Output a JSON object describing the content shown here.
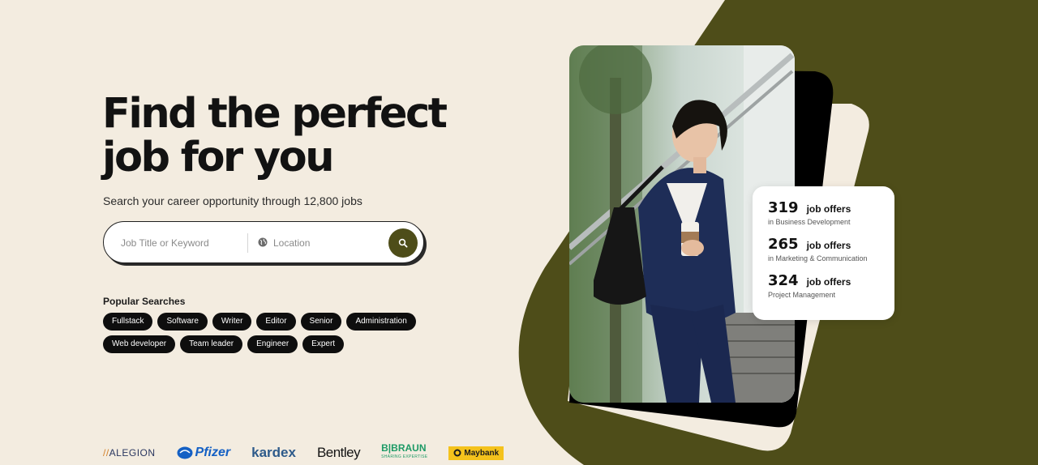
{
  "hero": {
    "title_line1": "Find the perfect",
    "title_line2": "job for you",
    "subtitle": "Search your career opportunity through 12,800 jobs"
  },
  "search": {
    "job_placeholder": "Job Title or Keyword",
    "location_placeholder": "Location",
    "icons": {
      "location": "globe-icon",
      "submit": "search-icon"
    }
  },
  "popular": {
    "heading": "Popular Searches",
    "row1": [
      "Fullstack",
      "Software",
      "Writer",
      "Editor",
      "Senior",
      "Administration"
    ],
    "row2": [
      "Web developer",
      "Team leader",
      "Engineer",
      "Expert"
    ]
  },
  "stats": [
    {
      "count": "319",
      "label": "job offers",
      "category": "in Business Development"
    },
    {
      "count": "265",
      "label": "job offers",
      "category": "in Marketing & Communication"
    },
    {
      "count": "324",
      "label": "job offers",
      "category": "Project Management"
    }
  ],
  "logos": {
    "alegion_prefix": "//",
    "alegion": "ALEGION",
    "pfizer": "Pfizer",
    "kardex": "kardex",
    "bentley": "Bentley",
    "bbraun": "B|BRAUN",
    "bbraun_tagline": "SHARING EXPERTISE",
    "maybank": "Maybank"
  },
  "colors": {
    "background": "#f3ece0",
    "accent_olive": "#4e4d19",
    "tag_bg": "#0e0e0e",
    "card_black": "#000000"
  }
}
